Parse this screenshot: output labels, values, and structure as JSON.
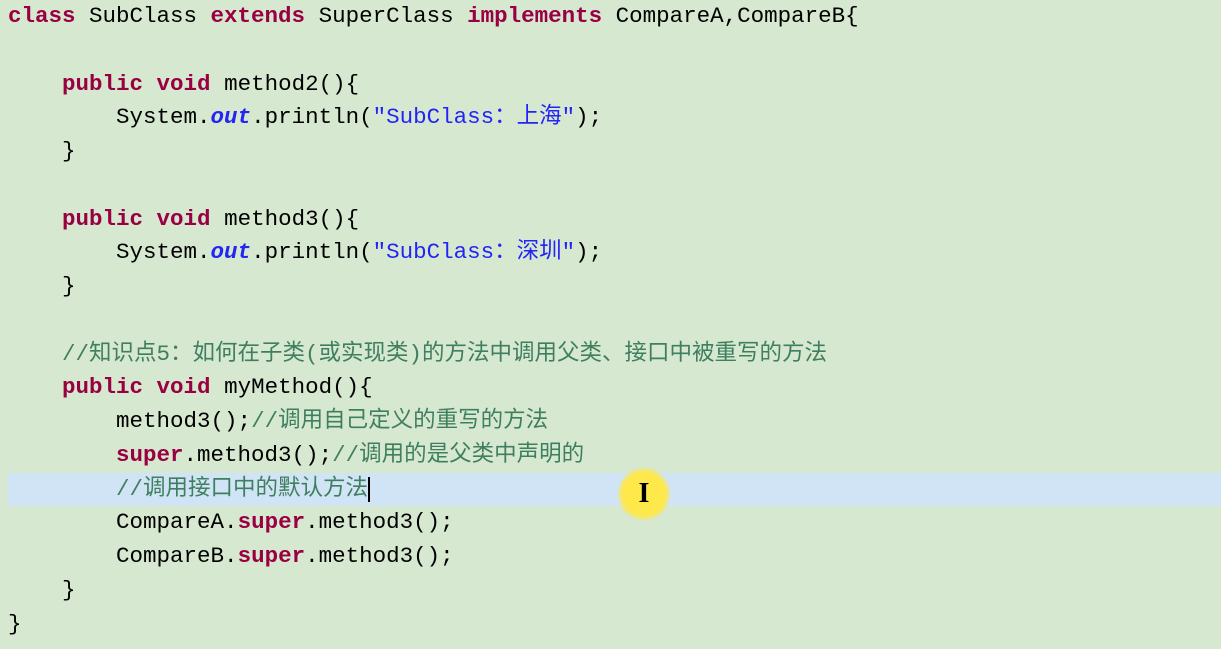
{
  "code": {
    "l1": {
      "kw1": "class",
      "t1": " SubClass ",
      "kw2": "extends",
      "t2": " SuperClass ",
      "kw3": "implements",
      "t3": " CompareA,CompareB{"
    },
    "l3": {
      "pad": "    ",
      "kw1": "public",
      "sp": " ",
      "kw2": "void",
      "t1": " method2(){"
    },
    "l4": {
      "pad": "        ",
      "t1": "System.",
      "static": "out",
      "t2": ".println(",
      "str": "\"SubClass：上海\"",
      "t3": ");"
    },
    "l5": {
      "t": "    }"
    },
    "l7": {
      "pad": "    ",
      "kw1": "public",
      "sp": " ",
      "kw2": "void",
      "t1": " method3(){"
    },
    "l8": {
      "pad": "        ",
      "t1": "System.",
      "static": "out",
      "t2": ".println(",
      "str": "\"SubClass：深圳\"",
      "t3": ");"
    },
    "l9": {
      "t": "    }"
    },
    "l11": {
      "pad": "    ",
      "c": "//知识点5：如何在子类(或实现类)的方法中调用父类、接口中被重写的方法"
    },
    "l12": {
      "pad": "    ",
      "kw1": "public",
      "sp": " ",
      "kw2": "void",
      "t1": " myMethod(){"
    },
    "l13": {
      "pad": "        ",
      "t1": "method3();",
      "c": "//调用自己定义的重写的方法"
    },
    "l14": {
      "pad": "        ",
      "kw": "super",
      "t1": ".method3();",
      "c": "//调用的是父类中声明的"
    },
    "l15": {
      "pad": "        ",
      "c": "//调用接口中的默认方法"
    },
    "l16": {
      "pad": "        ",
      "t1": "CompareA.",
      "kw": "super",
      "t2": ".method3();"
    },
    "l17": {
      "pad": "        ",
      "t1": "CompareB.",
      "kw": "super",
      "t2": ".method3();"
    },
    "l18": {
      "t": "    }"
    },
    "l19": {
      "t": "}"
    }
  },
  "cursor_icon": "I"
}
